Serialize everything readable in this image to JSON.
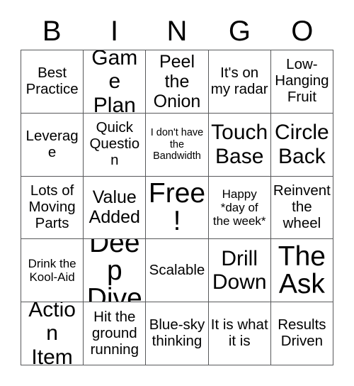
{
  "header": {
    "letters": [
      "B",
      "I",
      "N",
      "G",
      "O"
    ]
  },
  "grid": {
    "rows": 5,
    "columns": 5,
    "border_color": "#58595b",
    "background_color": "#ffffff",
    "text_color": "#000000",
    "cells": [
      {
        "text": "Best Practice",
        "size": "md"
      },
      {
        "text": "Game Plan",
        "size": "xl"
      },
      {
        "text": "Peel the Onion",
        "size": "lg"
      },
      {
        "text": "It's on my radar",
        "size": "md"
      },
      {
        "text": "Low-Hanging Fruit",
        "size": "md"
      },
      {
        "text": "Leverage",
        "size": "md"
      },
      {
        "text": "Quick Question",
        "size": "md"
      },
      {
        "text": "I don't have the Bandwidth",
        "size": "xs"
      },
      {
        "text": "Touch Base",
        "size": "xl"
      },
      {
        "text": "Circle Back",
        "size": "xl"
      },
      {
        "text": "Lots of Moving Parts",
        "size": "md"
      },
      {
        "text": "Value Added",
        "size": "lg"
      },
      {
        "text": "Free!",
        "size": "xxl"
      },
      {
        "text": "Happy *day of the week*",
        "size": "sm"
      },
      {
        "text": "Reinvent the wheel",
        "size": "md"
      },
      {
        "text": "Drink the Kool-Aid",
        "size": "sm"
      },
      {
        "text": "Deep Dive",
        "size": "xxl"
      },
      {
        "text": "Scalable",
        "size": "md"
      },
      {
        "text": "Drill Down",
        "size": "xl"
      },
      {
        "text": "The Ask",
        "size": "xxl"
      },
      {
        "text": "Action Item",
        "size": "xl"
      },
      {
        "text": "Hit the ground running",
        "size": "md"
      },
      {
        "text": "Blue-sky thinking",
        "size": "md"
      },
      {
        "text": "It is what it is",
        "size": "md"
      },
      {
        "text": "Results Driven",
        "size": "md"
      }
    ]
  }
}
